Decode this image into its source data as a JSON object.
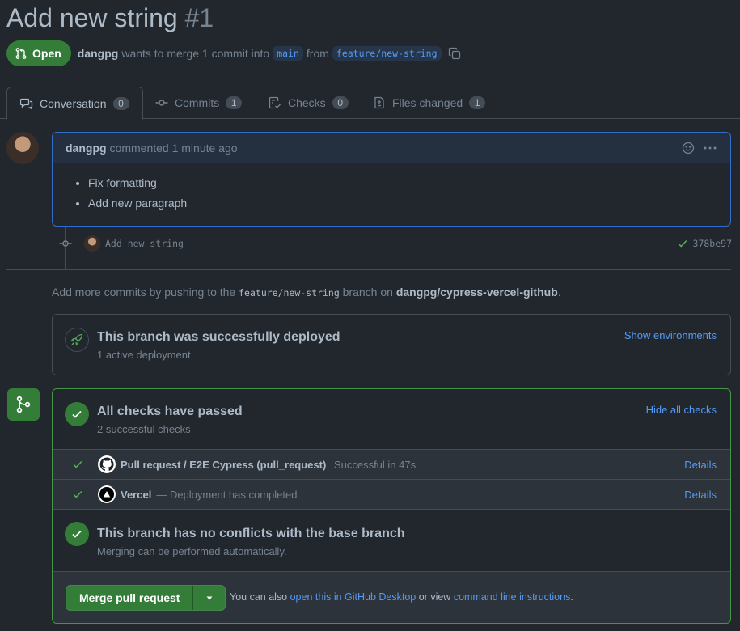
{
  "pr": {
    "title": "Add new string",
    "number": "#1",
    "state": "Open",
    "author": "dangpg",
    "merge_text": "wants to merge 1 commit into",
    "base_branch": "main",
    "from_text": "from",
    "head_branch": "feature/new-string"
  },
  "tabs": [
    {
      "label": "Conversation",
      "count": "0"
    },
    {
      "label": "Commits",
      "count": "1"
    },
    {
      "label": "Checks",
      "count": "0"
    },
    {
      "label": "Files changed",
      "count": "1"
    }
  ],
  "comment": {
    "author": "dangpg",
    "action": "commented",
    "time": "1 minute ago",
    "items": [
      "Fix formatting",
      "Add new paragraph"
    ]
  },
  "commit": {
    "message": "Add new string",
    "sha": "378be97"
  },
  "push_hint": {
    "prefix": "Add more commits by pushing to the",
    "branch": "feature/new-string",
    "middle": "branch on",
    "repo": "dangpg/cypress-vercel-github",
    "suffix": "."
  },
  "deployment": {
    "title": "This branch was successfully deployed",
    "subtitle": "1 active deployment",
    "action": "Show environments"
  },
  "checks": {
    "title": "All checks have passed",
    "subtitle": "2 successful checks",
    "action": "Hide all checks",
    "items": [
      {
        "name": "Pull request / E2E Cypress (pull_request)",
        "desc": "Successful in 47s",
        "details": "Details"
      },
      {
        "name": "Vercel",
        "desc": "— Deployment has completed",
        "details": "Details"
      }
    ]
  },
  "conflicts": {
    "title": "This branch has no conflicts with the base branch",
    "subtitle": "Merging can be performed automatically."
  },
  "merge": {
    "button": "Merge pull request",
    "hint_prefix": "You can also",
    "desktop_link": "open this in GitHub Desktop",
    "hint_middle": "or view",
    "cli_link": "command line instructions",
    "hint_suffix": "."
  },
  "colors": {
    "background": "#22272e",
    "success": "#347d39",
    "accent": "#539bf5",
    "border": "#444c56"
  }
}
